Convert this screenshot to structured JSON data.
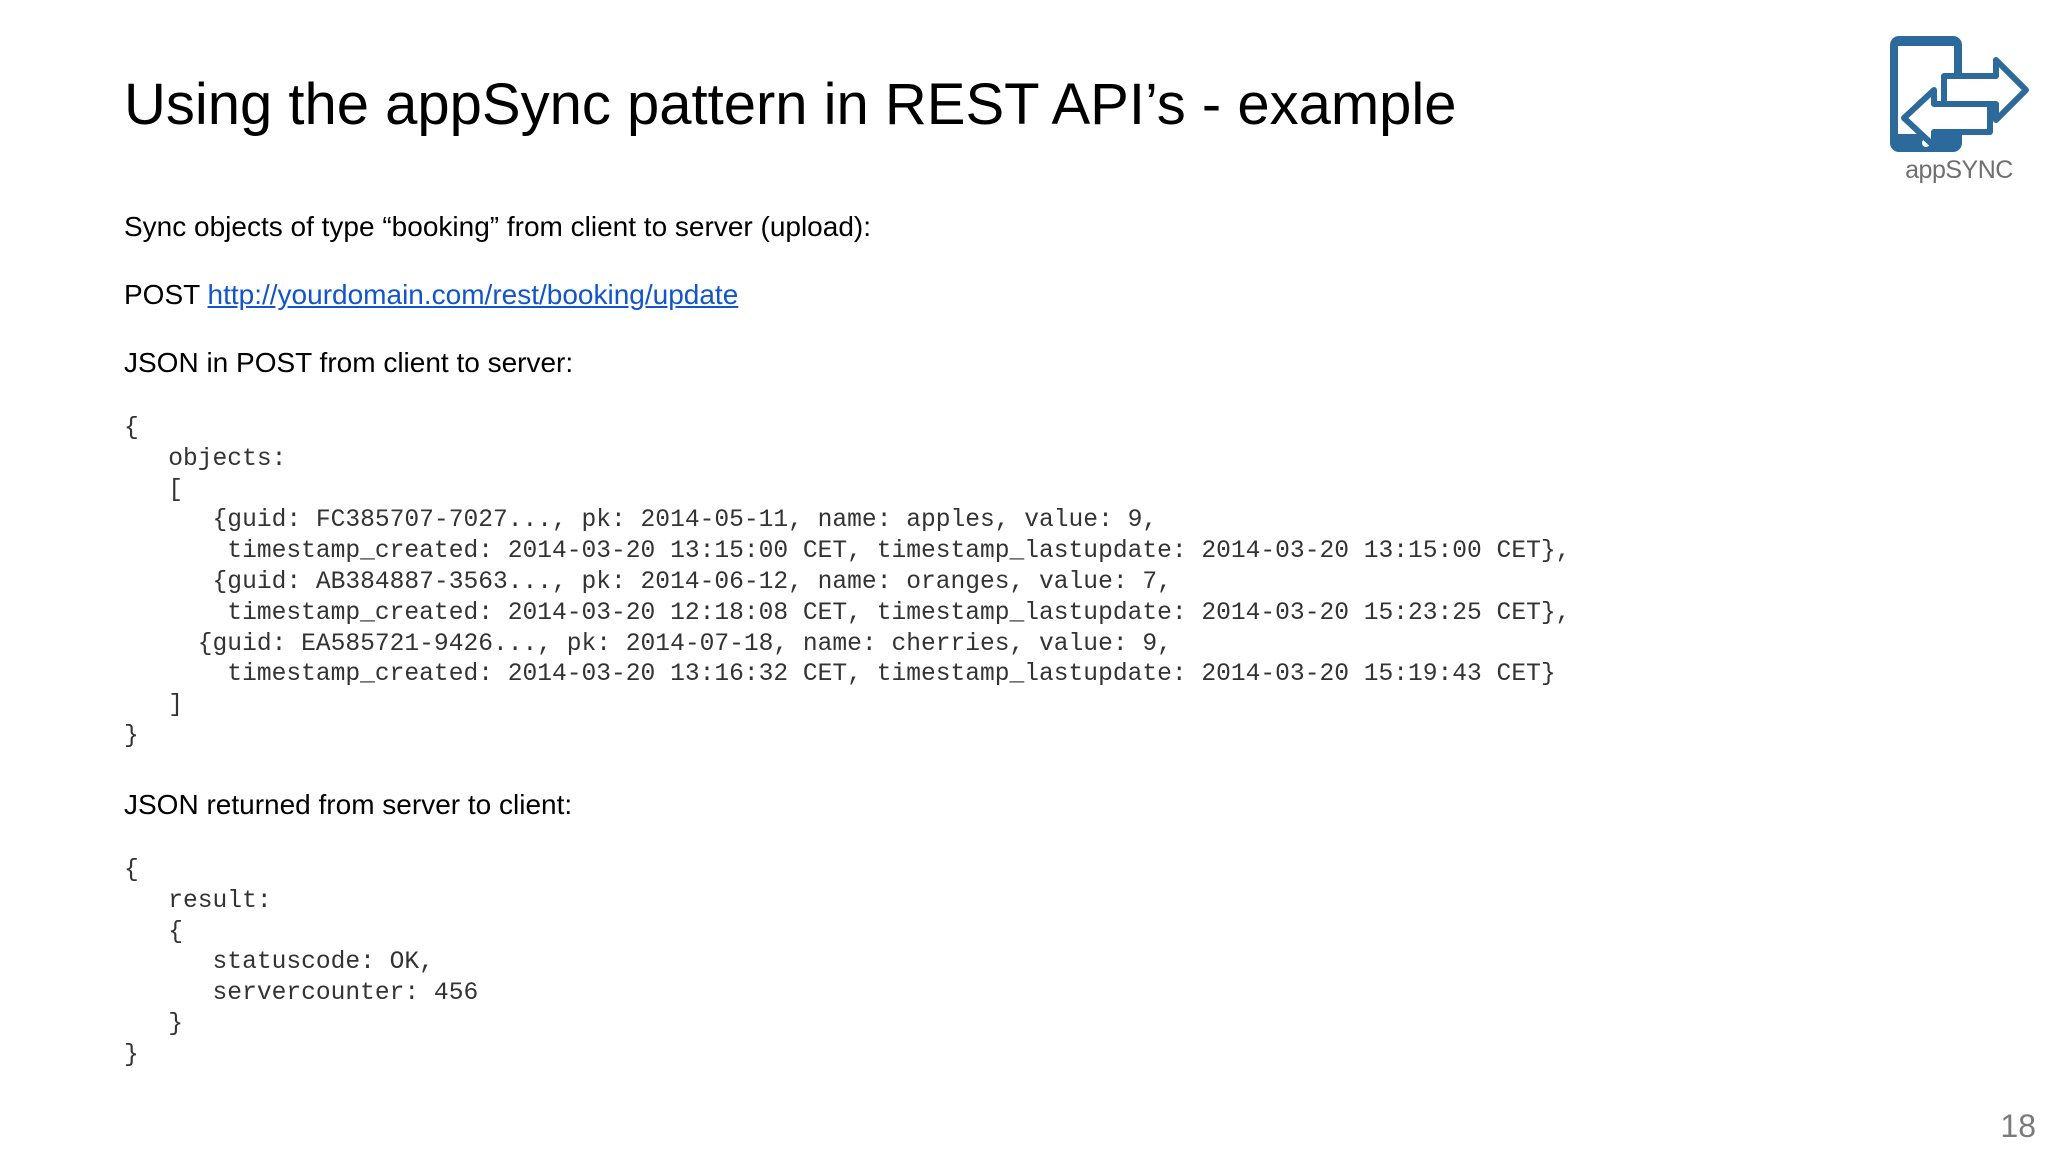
{
  "slide": {
    "title": "Using the appSync pattern in REST API’s - example",
    "intro": "Sync objects of type “booking” from client to server (upload):",
    "post_method": "POST",
    "post_url": "http://yourdomain.com/rest/booking/update",
    "request_heading": "JSON in POST from client to server:",
    "request_code": [
      "{",
      "   objects:",
      "   [",
      "      {guid: FC385707-7027..., pk: 2014-05-11, name: apples, value: 9,",
      "       timestamp_created: 2014-03-20 13:15:00 CET, timestamp_lastupdate: 2014-03-20 13:15:00 CET},",
      "      {guid: AB384887-3563..., pk: 2014-06-12, name: oranges, value: 7,",
      "       timestamp_created: 2014-03-20 12:18:08 CET, timestamp_lastupdate: 2014-03-20 15:23:25 CET},",
      "     {guid: EA585721-9426..., pk: 2014-07-18, name: cherries, value: 9,",
      "       timestamp_created: 2014-03-20 13:16:32 CET, timestamp_lastupdate: 2014-03-20 15:19:43 CET}",
      "   ]",
      "}"
    ],
    "response_heading": "JSON returned from server to client:",
    "response_code": [
      "{",
      "   result:",
      "   {",
      "      statuscode: OK,",
      "      servercounter: 456",
      "   }",
      "}"
    ],
    "logo_text": "appSYNC",
    "logo_icon": "phone-sync-arrows-icon",
    "page_number": "18"
  },
  "colors": {
    "logo_blue": "#2b6a9a",
    "link": "#1155cc",
    "code_text": "#333333"
  }
}
